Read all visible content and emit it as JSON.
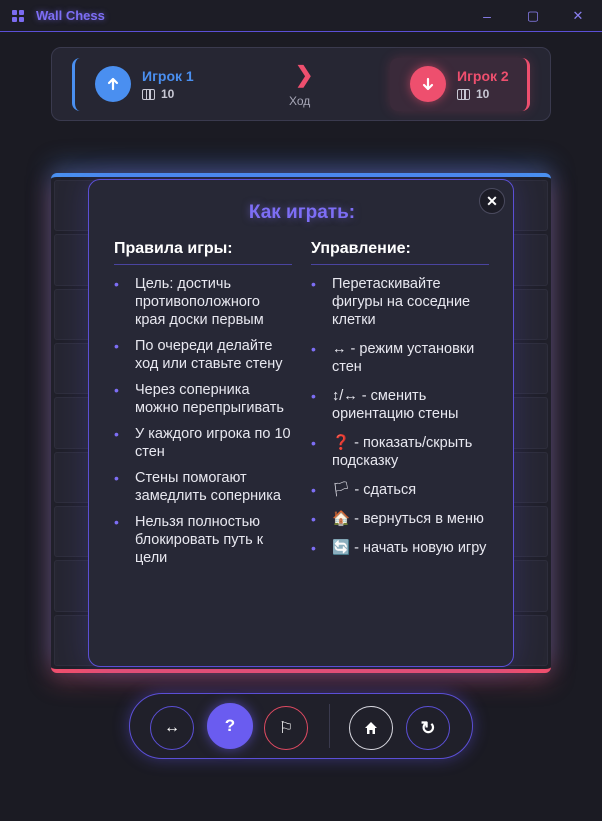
{
  "window": {
    "title": "Wall Chess",
    "minimize_glyph": "–",
    "maximize_glyph": "▢",
    "close_glyph": "✕"
  },
  "players": {
    "p1": {
      "name": "Игрок 1",
      "walls": "10",
      "icon": "arrow-up-icon",
      "color": "#4a8ff0"
    },
    "p2": {
      "name": "Игрок 2",
      "walls": "10",
      "icon": "arrow-down-icon",
      "color": "#ee4f6e"
    },
    "turn_label": "Ход",
    "turn_arrow": "❯"
  },
  "modal": {
    "title": "Как играть:",
    "close_glyph": "✕",
    "rules": {
      "heading": "Правила игры:",
      "items": [
        "Цель: достичь противоположного края доски первым",
        "По очереди делайте ход или ставьте стену",
        "Через соперника можно перепрыгивать",
        "У каждого игрока по 10 стен",
        "Стены помогают замедлить соперника",
        "Нельзя полностью блокировать путь к цели"
      ]
    },
    "controls": {
      "heading": "Управление:",
      "items": [
        "Перетаскивайте фигуры на соседние клетки",
        "↔ - режим установки стен",
        "↕/↔ - сменить ориентацию стены",
        "❓ - показать/скрыть подсказку",
        "🏳 - сдаться",
        "🏠 - вернуться в меню",
        "🔄 - начать новую игру"
      ]
    }
  },
  "toolbar": {
    "wall_mode": "↔",
    "hint": "?",
    "surrender": "⚐",
    "home": "⌂",
    "new_game": "↻"
  },
  "colors": {
    "accent": "#5b4fd6",
    "player1": "#4a8ff0",
    "player2": "#ee4f6e"
  }
}
